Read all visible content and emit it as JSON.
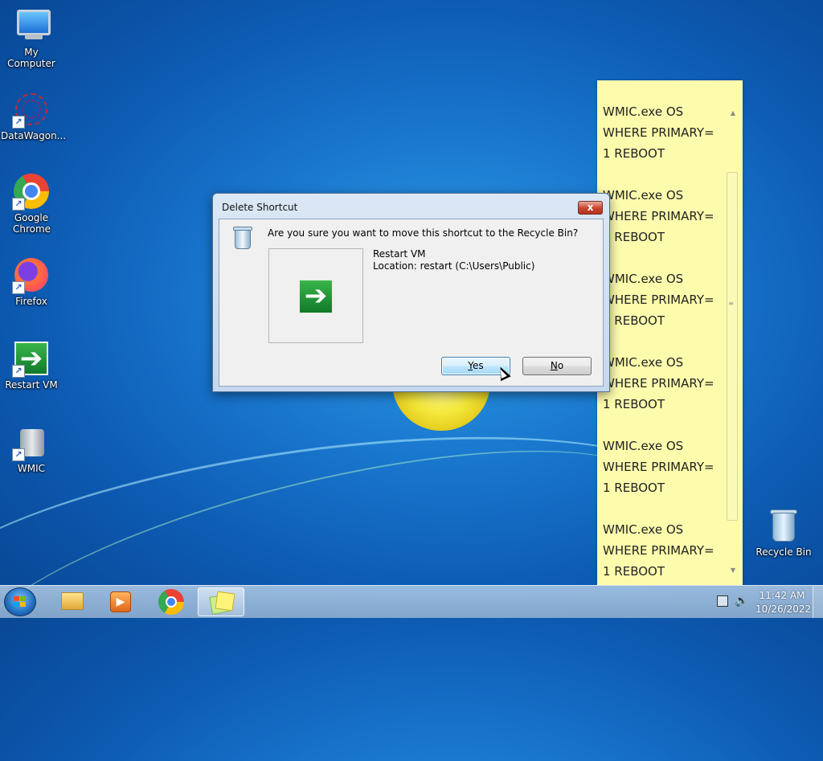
{
  "desktop": {
    "icons": [
      {
        "label": "My Computer",
        "icon": "computer-icon"
      },
      {
        "label": "DataWagon...",
        "icon": "datawagon-icon"
      },
      {
        "label": "Google Chrome",
        "icon": "chrome-icon"
      },
      {
        "label": "Firefox",
        "icon": "firefox-icon"
      },
      {
        "label": "Restart VM",
        "icon": "green-arrow-icon"
      },
      {
        "label": "WMIC",
        "icon": "wmic-icon"
      },
      {
        "label": "Recycle Bin",
        "icon": "recycle-bin-icon"
      }
    ]
  },
  "sticky_note": {
    "blocks": [
      [
        "WMIC.exe OS",
        "WHERE PRIMARY=",
        "1 REBOOT"
      ],
      [
        "WMIC.exe OS",
        "WHERE PRIMARY=",
        "1 REBOOT"
      ],
      [
        "WMIC.exe OS",
        "WHERE PRIMARY=",
        "1 REBOOT"
      ],
      [
        "WMIC.exe OS",
        "WHERE PRIMARY=",
        "1 REBOOT"
      ],
      [
        "WMIC.exe OS",
        "WHERE PRIMARY=",
        "1 REBOOT"
      ],
      [
        "WMIC.exe OS",
        "WHERE PRIMARY=",
        "1 REBOOT"
      ]
    ],
    "background": "#fdfcad"
  },
  "dialog": {
    "title": "Delete Shortcut",
    "close_label": "x",
    "question": "Are you sure you want to move this shortcut to the Recycle Bin?",
    "item_name": "Restart VM",
    "item_location": "Location: restart (C:\\Users\\Public)",
    "yes_key": "Y",
    "yes_rest": "es",
    "no_key": "N",
    "no_rest": "o"
  },
  "taskbar": {
    "apps": [
      "windows-explorer-icon",
      "media-player-icon",
      "chrome-icon",
      "sticky-notes-icon"
    ],
    "active_app": "sticky-notes-icon",
    "time": "11:42 AM",
    "date": "10/26/2022"
  },
  "colors": {
    "desktop_blue": "#1a78cf",
    "taskbar": "#a8c4e0",
    "close_red": "#c8432d"
  }
}
